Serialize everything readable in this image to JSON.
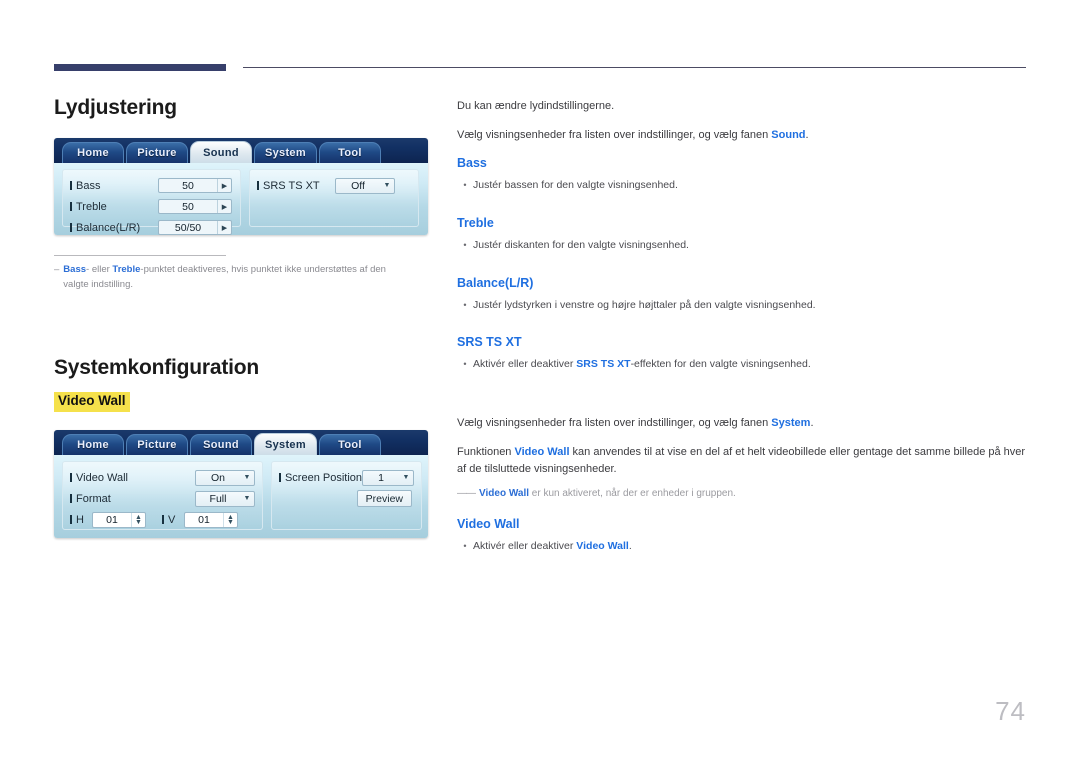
{
  "page": {
    "number": "74"
  },
  "sections": [
    {
      "title": "Lydjustering",
      "intro": [
        {
          "text": "Du kan ændre lydindstillingerne."
        },
        {
          "pre": "Vælg visningsenheder fra listen over indstillinger, og vælg fanen ",
          "strong": "Sound",
          "post": "."
        }
      ],
      "items": [
        {
          "head": "Bass",
          "bullet_pre": "Justér bassen for den valgte visningsenhed.",
          "bullet_strong": "",
          "bullet_post": ""
        },
        {
          "head": "Treble",
          "bullet_pre": "Justér diskanten for den valgte visningsenhed.",
          "bullet_strong": "",
          "bullet_post": ""
        },
        {
          "head": "Balance(L/R)",
          "bullet_pre": "Justér lydstyrken i venstre og højre højttaler på den valgte visningsenhed.",
          "bullet_strong": "",
          "bullet_post": ""
        },
        {
          "head": "SRS TS XT",
          "bullet_pre": "Aktivér eller deaktiver ",
          "bullet_strong": "SRS TS XT",
          "bullet_post": "-effekten for den valgte visningsenhed."
        }
      ],
      "footnote": {
        "dash": "–",
        "part1": "Bass",
        "mid1": "- eller ",
        "part2": "Treble",
        "tail": "-punktet deaktiveres, hvis punktet ikke understøttes af den valgte indstilling."
      }
    },
    {
      "title": "Systemkonfiguration",
      "badge": "Video Wall",
      "intro": [
        {
          "pre": "Vælg visningsenheder fra listen over indstillinger, og vælg fanen ",
          "strong": "System",
          "post": "."
        },
        {
          "pre": "Funktionen ",
          "strong": "Video Wall",
          "post": " kan anvendes til at vise en del af et helt videobillede eller gentage det samme billede på hver af de tilsluttede visningsenheder."
        }
      ],
      "note": {
        "dash": "——",
        "strong": "Video Wall",
        "text": " er kun aktiveret, når der er enheder i gruppen."
      },
      "items": [
        {
          "head": "Video Wall",
          "bullet_pre": "Aktivér eller deaktiver ",
          "bullet_strong": "Video Wall",
          "bullet_post": "."
        }
      ]
    }
  ],
  "sound_panel": {
    "tabs": [
      {
        "label": "Home",
        "active": false
      },
      {
        "label": "Picture",
        "active": false
      },
      {
        "label": "Sound",
        "active": true
      },
      {
        "label": "System",
        "active": false
      },
      {
        "label": "Tool",
        "active": false
      }
    ],
    "left_rows": [
      {
        "label": "Bass",
        "value": "50"
      },
      {
        "label": "Treble",
        "value": "50"
      },
      {
        "label": "Balance(L/R)",
        "value": "50/50"
      }
    ],
    "right_rows": [
      {
        "label": "SRS TS XT",
        "value": "Off"
      }
    ]
  },
  "system_panel": {
    "tabs": [
      {
        "label": "Home",
        "active": false
      },
      {
        "label": "Picture",
        "active": false
      },
      {
        "label": "Sound",
        "active": false
      },
      {
        "label": "System",
        "active": true
      },
      {
        "label": "Tool",
        "active": false
      }
    ],
    "video_wall": {
      "label": "Video Wall",
      "value": "On"
    },
    "format": {
      "label": "Format",
      "value": "Full"
    },
    "h": {
      "label": "H",
      "value": "01"
    },
    "v": {
      "label": "V",
      "value": "01"
    },
    "screen_position": {
      "label": "Screen Position",
      "value": "1"
    },
    "preview_button": "Preview"
  },
  "colors": {
    "accent_blue": "#1f6fe0",
    "header_bar": "#373f6b",
    "highlight_yellow": "#f5e14b"
  }
}
